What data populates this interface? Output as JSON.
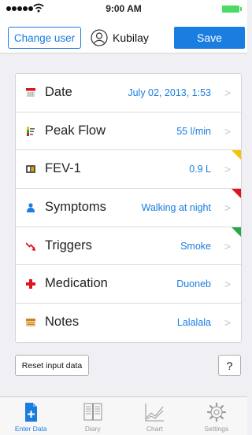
{
  "status_bar": {
    "time": "9:00 AM",
    "signal_icon": "signal-dots-icon",
    "wifi_icon": "wifi-icon",
    "battery_icon": "battery-icon"
  },
  "header": {
    "change_user_label": "Change user",
    "user_name": "Kubilay",
    "user_icon": "user-circle-icon",
    "save_label": "Save"
  },
  "form": {
    "rows": [
      {
        "label": "Date",
        "value": "July 02, 2013, 1:53",
        "icon": "calendar-icon",
        "corner": null
      },
      {
        "label": "Peak Flow",
        "value": "55 l/min",
        "icon": "peak-flow-meter-icon",
        "corner": null
      },
      {
        "label": "FEV-1",
        "value": "0.9 L",
        "icon": "spirometer-icon",
        "corner": "#f5c400"
      },
      {
        "label": "Symptoms",
        "value": "Walking at night",
        "icon": "person-icon",
        "corner": "#e0141e"
      },
      {
        "label": "Triggers",
        "value": "Smoke",
        "icon": "trigger-arrow-icon",
        "corner": "#27a844"
      },
      {
        "label": "Medication",
        "value": "Duoneb",
        "icon": "red-cross-icon",
        "corner": null
      },
      {
        "label": "Notes",
        "value": "Lalalala",
        "icon": "notes-icon",
        "corner": null
      }
    ]
  },
  "actions": {
    "reset_label": "Reset input data",
    "help_label": "?"
  },
  "tabs": [
    {
      "label": "Enter Data",
      "icon": "document-add-icon",
      "active": true
    },
    {
      "label": "Diary",
      "icon": "book-icon",
      "active": false
    },
    {
      "label": "Chart",
      "icon": "line-chart-icon",
      "active": false
    },
    {
      "label": "Settings",
      "icon": "gear-icon",
      "active": false
    }
  ],
  "colors": {
    "accent": "#1a7de0",
    "background": "#efeff4",
    "battery": "#4cd964"
  }
}
